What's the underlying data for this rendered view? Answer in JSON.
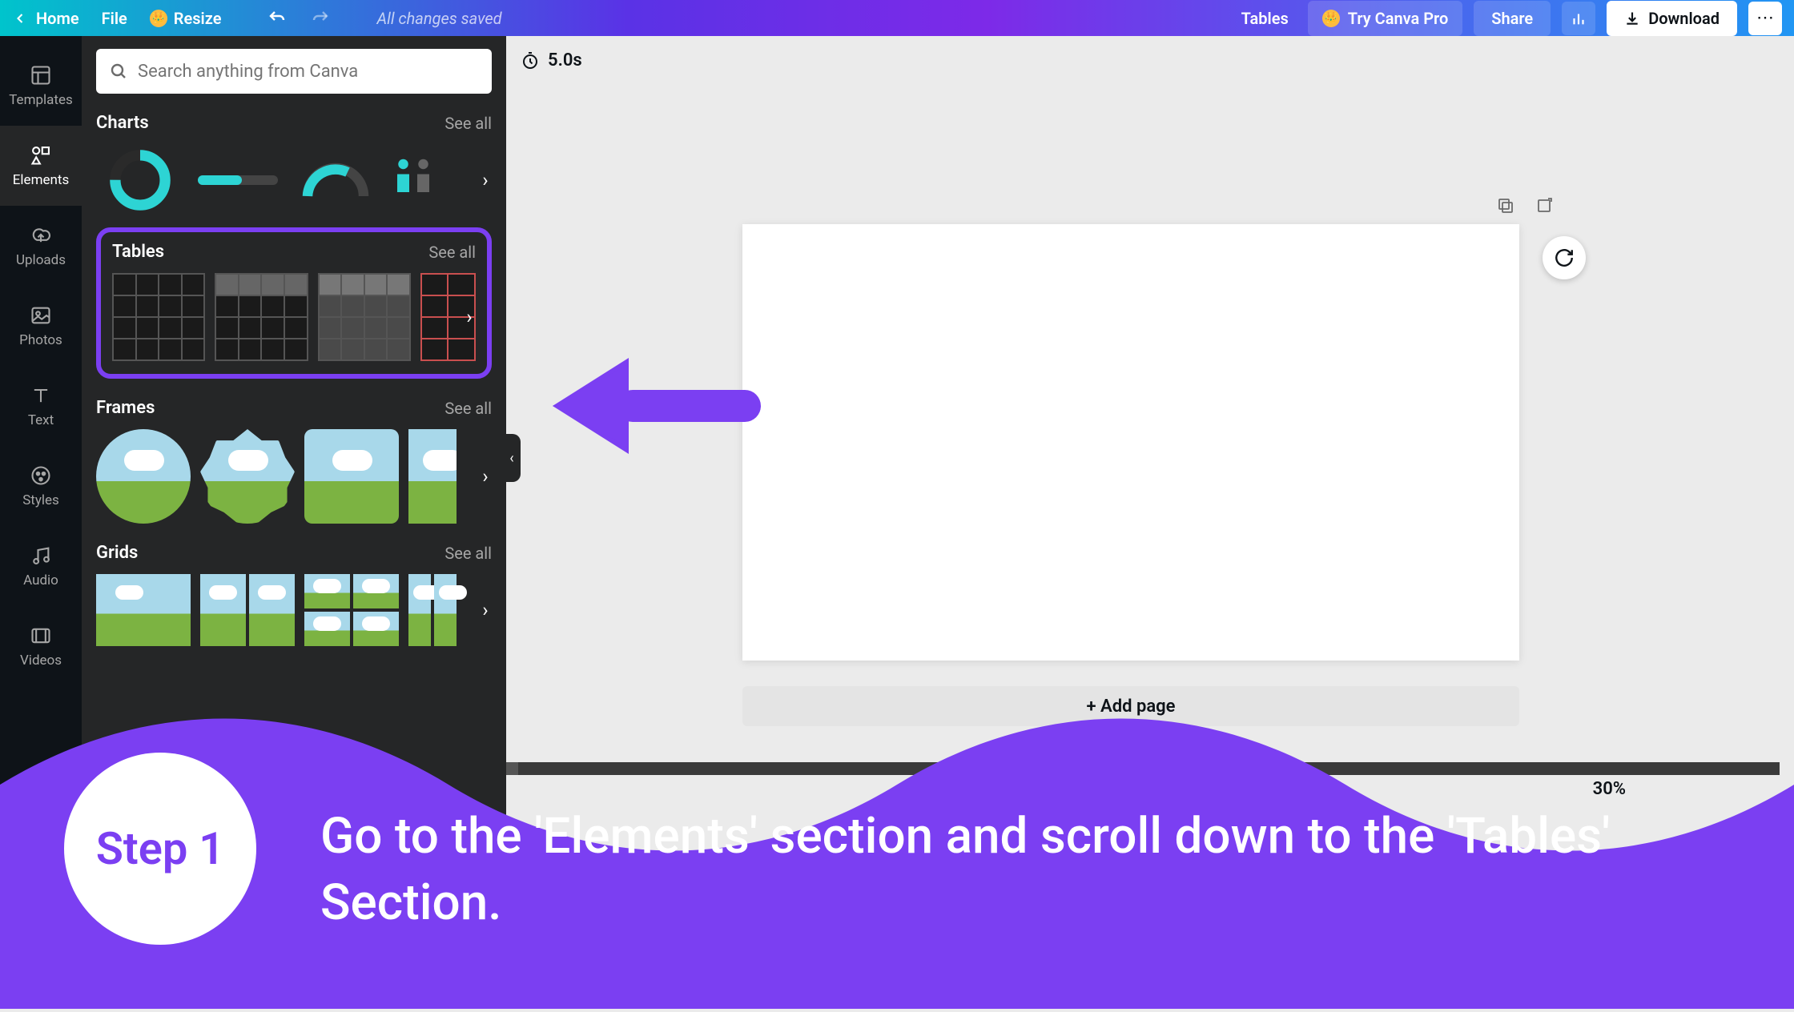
{
  "topbar": {
    "home": "Home",
    "file": "File",
    "resize": "Resize",
    "saved": "All changes saved",
    "tables_link": "Tables",
    "try_pro": "Try Canva Pro",
    "share": "Share",
    "download": "Download"
  },
  "search": {
    "placeholder": "Search anything from Canva"
  },
  "iconbar": {
    "templates": "Templates",
    "elements": "Elements",
    "uploads": "Uploads",
    "photos": "Photos",
    "text": "Text",
    "styles": "Styles",
    "audio": "Audio",
    "videos": "Videos"
  },
  "sections": {
    "charts": {
      "title": "Charts",
      "seeall": "See all"
    },
    "tables": {
      "title": "Tables",
      "seeall": "See all"
    },
    "frames": {
      "title": "Frames",
      "seeall": "See all"
    },
    "grids": {
      "title": "Grids",
      "seeall": "See all"
    }
  },
  "timer": "5.0s",
  "add_page": "+ Add page",
  "zoom": "30%",
  "annotation": {
    "step_label": "Step 1",
    "text": "Go to the 'Elements' section and scroll down to the 'Tables' Section."
  }
}
